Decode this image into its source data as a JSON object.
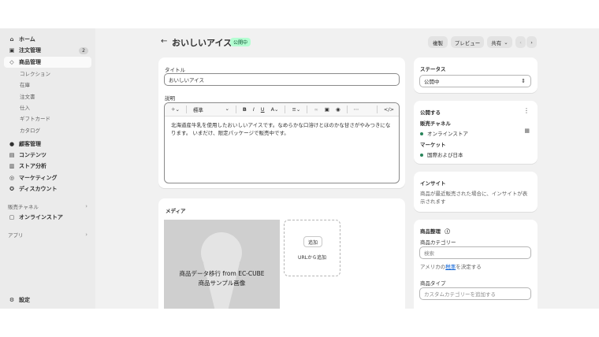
{
  "sidebar": {
    "items": [
      {
        "label": "ホーム",
        "icon": "home-icon"
      },
      {
        "label": "注文管理",
        "icon": "inbox-icon",
        "badge": "2"
      },
      {
        "label": "商品管理",
        "icon": "tag-icon",
        "active": true
      }
    ],
    "product_subitems": [
      "コレクション",
      "在庫",
      "注文書",
      "仕入",
      "ギフトカード",
      "カタログ"
    ],
    "items2": [
      {
        "label": "顧客管理",
        "icon": "person-icon"
      },
      {
        "label": "コンテンツ",
        "icon": "content-icon"
      },
      {
        "label": "ストア分析",
        "icon": "chart-icon"
      },
      {
        "label": "マーケティング",
        "icon": "target-icon"
      },
      {
        "label": "ディスカウント",
        "icon": "discount-icon"
      }
    ],
    "sales_channels_label": "販売チャネル",
    "online_store": "オンラインストア",
    "apps_label": "アプリ",
    "settings": "設定"
  },
  "header": {
    "title": "おいしいアイス",
    "status_badge": "公開中",
    "duplicate": "複製",
    "preview": "プレビュー",
    "share": "共有"
  },
  "main": {
    "title_label": "タイトル",
    "title_value": "おいしいアイス",
    "description_label": "説明",
    "toolbar": {
      "format": "標準"
    },
    "description_text": "北海道産牛乳を使用したおいしいアイスです。なめらかな口溶けとほのかな甘さがやみつきになります。 いまだけ、限定パッケージで販売中です。",
    "media_label": "メディア",
    "media_caption_line1": "商品データ移行 from EC-CUBE",
    "media_caption_line2": "商品サンプル画像",
    "add_button": "追加",
    "add_from_url": "URLから追加"
  },
  "side": {
    "status_label": "ステータス",
    "status_value": "公開中",
    "publish_label": "公開する",
    "sales_channel_label": "販売チャネル",
    "sales_channel_value": "オンラインストア",
    "market_label": "マーケット",
    "market_value": "国際および日本",
    "insights_label": "インサイト",
    "insights_text": "商品が最近販売された場合に、インサイトが表示されます",
    "organization_label": "商品整理",
    "category_label": "商品カテゴリー",
    "category_placeholder": "検索",
    "category_help_prefix": "アメリカの",
    "category_help_link": "税率",
    "category_help_suffix": "を決定する",
    "type_label": "商品タイプ",
    "type_placeholder": "カスタムカテゴリーを追加する"
  },
  "colors": {
    "background": "#f1f1f1",
    "sidebar": "#ebebeb",
    "status_badge_bg": "#b4fed2",
    "link": "#005bd3",
    "online_dot": "#29845a"
  }
}
